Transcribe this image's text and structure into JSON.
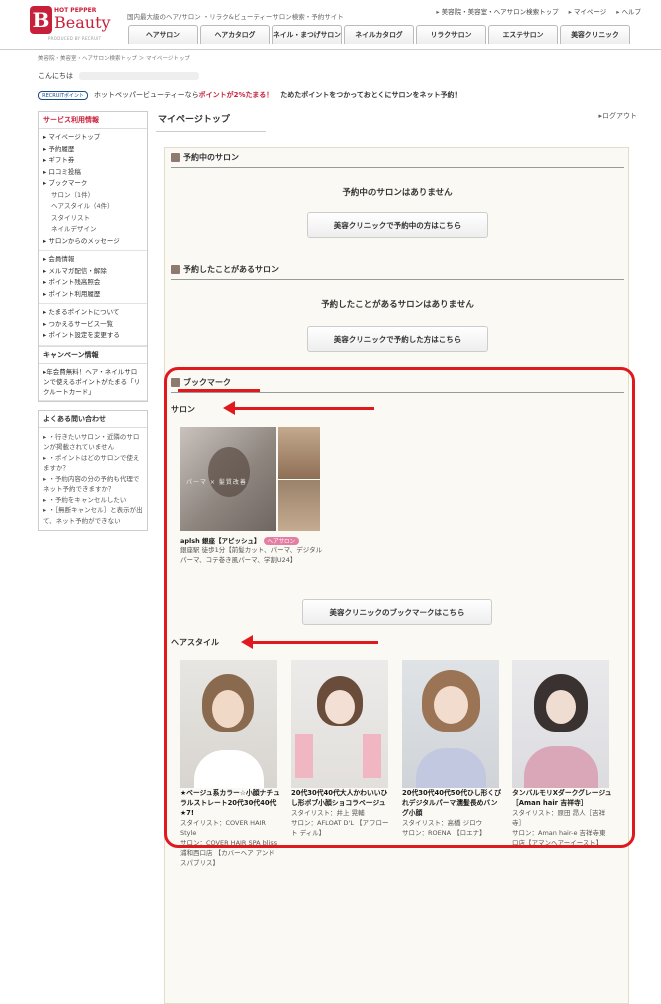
{
  "header": {
    "logo_hot": "HOT PEPPER",
    "logo_word": "Beauty",
    "logo_powered": "PRODUCED BY RECRUIT",
    "tagline": "国内最大級のヘア/サロン ・リラク&ビューティーサロン検索・予約サイト",
    "top_links": [
      "美容院・美容室・ヘアサロン検索トップ",
      "マイページ",
      "ヘルプ"
    ],
    "nav": [
      "ヘアサロン",
      "ヘアカタログ",
      "ネイル・まつげサロン",
      "ネイルカタログ",
      "リラクサロン",
      "エステサロン",
      "美容クリニック"
    ]
  },
  "breadcrumb": "美容院・美容室・ヘアサロン検索トップ ＞ マイページトップ",
  "greeting": "こんにちは",
  "promo": {
    "badge": "RECRUITポイント",
    "text1": "ホットペッパービューティーなら",
    "text2": "ポイントが2%たまる！",
    "text3": "ためたポイントをつかっておとくにサロンをネット予約！"
  },
  "sidebar": {
    "service_title": "サービス利用情報",
    "group1": [
      {
        "label": "マイページトップ",
        "sub": false
      },
      {
        "label": "予約履歴",
        "sub": false
      },
      {
        "label": "ギフト券",
        "sub": false
      },
      {
        "label": "口コミ投稿",
        "sub": false
      },
      {
        "label": "ブックマーク",
        "sub": false
      },
      {
        "label": "サロン（1件）",
        "sub": true
      },
      {
        "label": "ヘアスタイル（4件）",
        "sub": true
      },
      {
        "label": "スタイリスト",
        "sub": true
      },
      {
        "label": "ネイルデザイン",
        "sub": true
      },
      {
        "label": "サロンからのメッセージ",
        "sub": false
      }
    ],
    "group2": [
      "会員情報",
      "メルマガ配信・解除",
      "ポイント残高照会",
      "ポイント利用履歴"
    ],
    "group3": [
      "たまるポイントについて",
      "つかえるサービス一覧",
      "ポイント設定を変更する"
    ],
    "campaign_title": "キャンペーン情報",
    "campaign_text": "年会費無料！ヘア・ネイルサロンで使えるポイントがたまる「リクルートカード」",
    "faq_title": "よくある問い合わせ",
    "faq": [
      "・行きたいサロン・近隣のサロンが掲載されていません",
      "・ポイントはどのサロンで使えますか？",
      "・予約内容の分の予約も代理でネット予約できますか？",
      "・予約をキャンセルしたい",
      "・［無断キャンセル］と表示が出て、ネット予約ができない"
    ]
  },
  "main": {
    "title": "マイページトップ",
    "logout": "ログアウト",
    "current": {
      "title": "予約中のサロン",
      "empty": "予約中のサロンはありません",
      "button": "美容クリニックで予約中の方はこちら"
    },
    "past": {
      "title": "予約したことがあるサロン",
      "empty": "予約したことがあるサロンはありません",
      "button": "美容クリニックで予約した方はこちら"
    },
    "bookmark": {
      "title": "ブックマーク",
      "salon_head": "サロン",
      "salon": {
        "name": "aplsh 銀座【アピッシュ】",
        "tag": "ヘアサロン",
        "desc": "銀座駅 徒歩1分【前髪カット、パーマ、デジタルパーマ、コテ巻き風パーマ、学割U24】",
        "photo_caption": "パーマ × 髪質改善"
      },
      "salon_button": "美容クリニックのブックマークはこちら",
      "hair_head": "ヘアスタイル",
      "styles": [
        {
          "title": "★ベージュ系カラー☆小顔ナチュラルストレート20代30代40代★7!",
          "stylist": "スタイリスト：COVER HAIR Style",
          "salon": "サロン：COVER HAIR SPA bliss 浦和西口店 【カバーヘア アンド スパブリス】"
        },
        {
          "title": "20代30代40代大人かわいいひし形ボブ小顔ショコラベージュ",
          "stylist": "スタイリスト：井上 晃輔",
          "salon": "サロン：AFLOAT D'L 【アフロート ディル】"
        },
        {
          "title": "20代30代40代50代ひし形くびれデジタルパーマ濡髪長めバング小顔",
          "stylist": "スタイリスト：高橋 ジロウ",
          "salon": "サロン：ROENA 【ロエナ】"
        },
        {
          "title": "タンバルモリXダークグレージュ［Aman hair 吉祥寺］",
          "stylist": "スタイリスト：原田 昂人［吉祥寺］",
          "salon": "サロン：Aman hair-e 吉祥寺東口店【アマンヘアーイースト】"
        }
      ]
    }
  },
  "colors": {
    "brand": "#c8203a",
    "highlight": "#e0191e",
    "panel": "#fbf9f4"
  }
}
